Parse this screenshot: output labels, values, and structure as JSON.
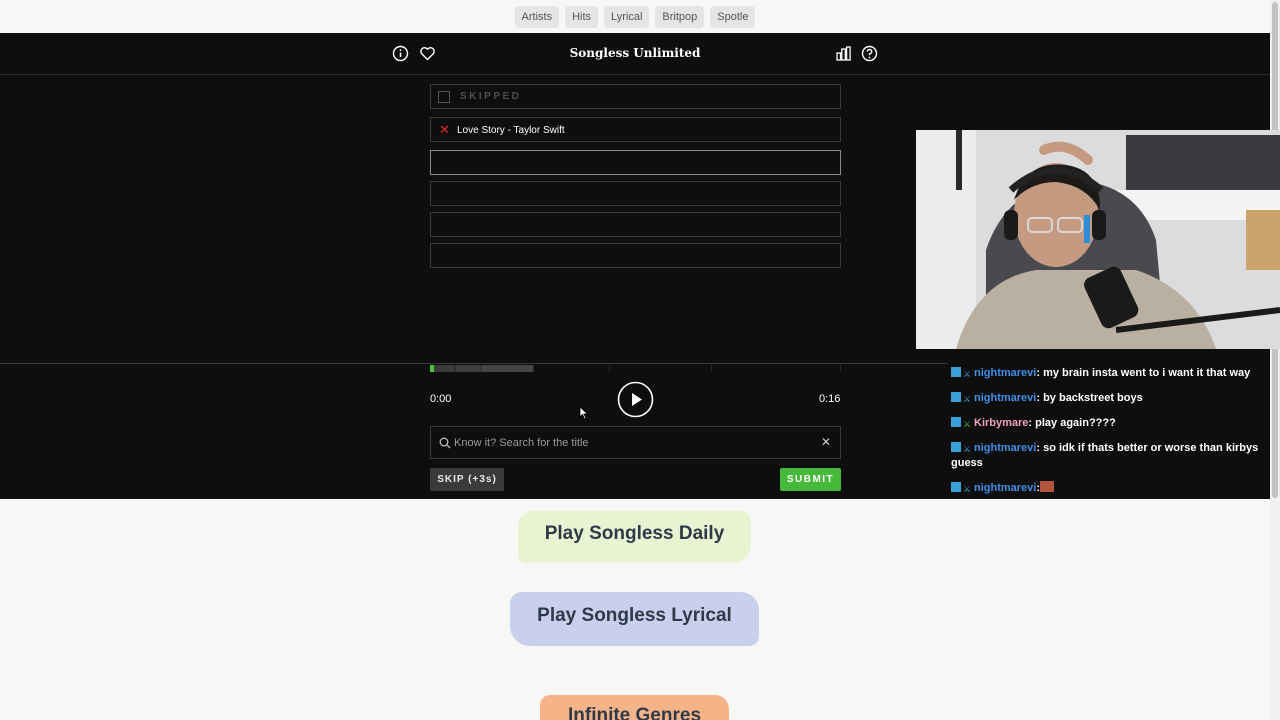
{
  "nav": {
    "pills": [
      "Artists",
      "Hits",
      "Lyrical",
      "Britpop",
      "Spotle"
    ]
  },
  "header": {
    "title": "Songless Unlimited"
  },
  "guesses": {
    "skipped_label": "SKIPPED",
    "wrong_guess": "Love Story - Taylor Swift"
  },
  "player": {
    "current_time": "0:00",
    "total_time": "0:16",
    "progress_fraction": 0.0
  },
  "search": {
    "placeholder": "Know it? Search for the title",
    "clear_icon": "✕"
  },
  "actions": {
    "skip_label": "SKIP (+3s)",
    "submit_label": "SUBMIT"
  },
  "more_modes": {
    "daily": "Play Songless Daily",
    "lyrical": "Play Songless Lyrical",
    "genres": "Infinite Genres"
  },
  "chat": {
    "messages": [
      {
        "user": "nightmarevi",
        "text": ": my brain insta went to i want it that way"
      },
      {
        "user": "nightmarevi",
        "text": ": by backstreet boys"
      },
      {
        "user": "Kirbymare",
        "text": ": play again????"
      },
      {
        "user": "nightmarevi",
        "text": ": so idk if thats better or worse than kirbys guess"
      },
      {
        "user": "nightmarevi",
        "text": ":"
      }
    ]
  },
  "colors": {
    "game_bg": "#0e0e0e",
    "accent_green": "#46b83a",
    "wrong_red": "#e02b2b",
    "chat_user_blue": "#3d8fe8",
    "chat_user_pink": "#f0a0b8"
  }
}
